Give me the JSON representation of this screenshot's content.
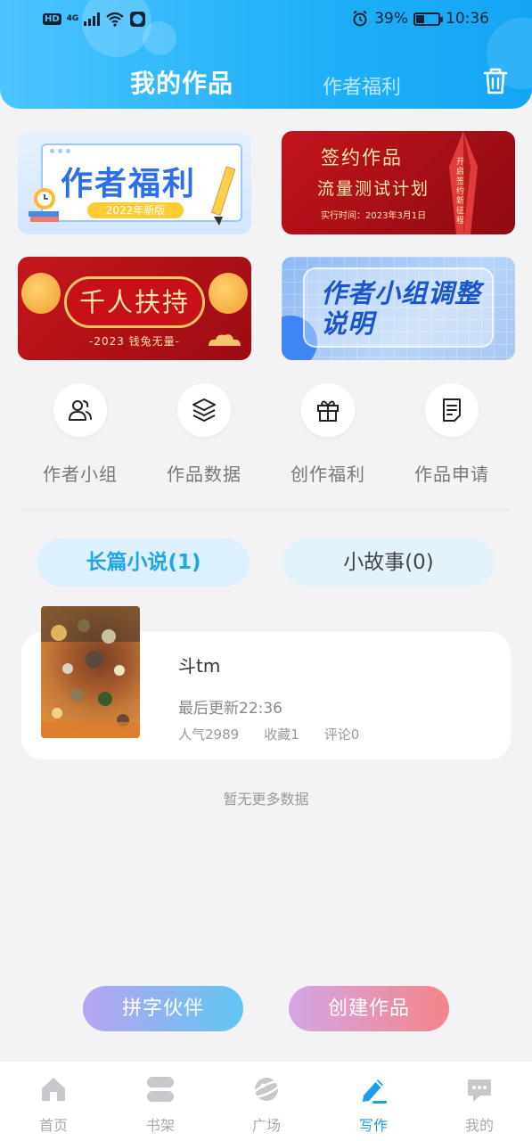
{
  "status_bar": {
    "hd": "HD",
    "net": "4G",
    "battery_percent": "39%",
    "battery_level": 0.39,
    "time": "10:36"
  },
  "header": {
    "tab_active": "我的作品",
    "tab_inactive": "作者福利"
  },
  "banners": {
    "author_welfare": {
      "title": "作者福利",
      "subtitle": "2022年新版"
    },
    "signed_works": {
      "line1": "签约作品",
      "line2": "流量测试计划",
      "line3": "实行时间：2023年3月1日",
      "side": "开启签约新征程"
    },
    "thousand_support": {
      "title": "千人扶持",
      "subtitle": "-2023 钱兔无量-"
    },
    "group_adjust": {
      "title": "作者小组调整说明"
    }
  },
  "quick_entries": [
    {
      "label": "作者小组",
      "icon": "users-icon"
    },
    {
      "label": "作品数据",
      "icon": "layers-icon"
    },
    {
      "label": "创作福利",
      "icon": "gift-icon"
    },
    {
      "label": "作品申请",
      "icon": "document-icon"
    }
  ],
  "segments": {
    "long_novel": "长篇小说(1)",
    "short_story": "小故事(0)"
  },
  "work": {
    "title": "斗tm",
    "last_update": "最后更新22:36",
    "popularity": "人气2989",
    "favorites": "收藏1",
    "comments": "评论0"
  },
  "no_more": "暂无更多数据",
  "actions": {
    "partner": "拼字伙伴",
    "create": "创建作品"
  },
  "nav": [
    {
      "label": "首页",
      "icon": "home-icon"
    },
    {
      "label": "书架",
      "icon": "bookshelf-icon"
    },
    {
      "label": "广场",
      "icon": "planet-icon"
    },
    {
      "label": "写作",
      "icon": "pen-icon",
      "active": true
    },
    {
      "label": "我的",
      "icon": "chat-bubble-icon"
    }
  ],
  "colors": {
    "header": "#1fb0f8",
    "accent": "#1a9fe8"
  }
}
